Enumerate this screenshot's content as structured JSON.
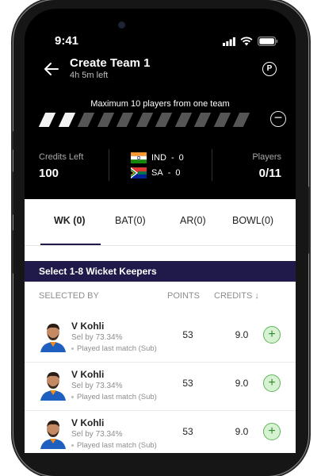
{
  "status": {
    "time": "9:41"
  },
  "header": {
    "title": "Create Team 1",
    "time_left": "4h 5m left",
    "badge": "P"
  },
  "note": "Maximum 10 players from one team",
  "progress": {
    "filled": 2,
    "total": 11
  },
  "stats": {
    "credits_label": "Credits Left",
    "credits_value": "100",
    "teams": [
      {
        "code": "IND",
        "count": "0"
      },
      {
        "code": "SA",
        "count": "0"
      }
    ],
    "players_label": "Players",
    "players_value": "0/11"
  },
  "tabs": [
    "WK (0)",
    "BAT(0)",
    "AR(0)",
    "BOWL(0)"
  ],
  "banner": "Select 1-8 Wicket Keepers",
  "columns": {
    "selected_by": "SELECTED BY",
    "points": "POINTS",
    "credits": "CREDITS ↓"
  },
  "players": [
    {
      "name": "V Kohli",
      "sel": "Sel by 73.34%",
      "played": "Played last match (Sub)",
      "points": "53",
      "credits": "9.0"
    },
    {
      "name": "V Kohli",
      "sel": "Sel by 73.34%",
      "played": "Played last match (Sub)",
      "points": "53",
      "credits": "9.0"
    },
    {
      "name": "V Kohli",
      "sel": "Sel by 73.34%",
      "played": "Played last match (Sub)",
      "points": "53",
      "credits": "9.0"
    }
  ],
  "colors": {
    "accent": "#1f1a4a",
    "add_bg": "#d6f2d3",
    "add_border": "#5fb35b"
  },
  "icons": [
    "back-arrow-icon",
    "p-badge-icon",
    "minus-icon",
    "add-icon",
    "signal-icon",
    "wifi-icon",
    "battery-icon",
    "india-flag-icon",
    "south-africa-flag-icon"
  ]
}
